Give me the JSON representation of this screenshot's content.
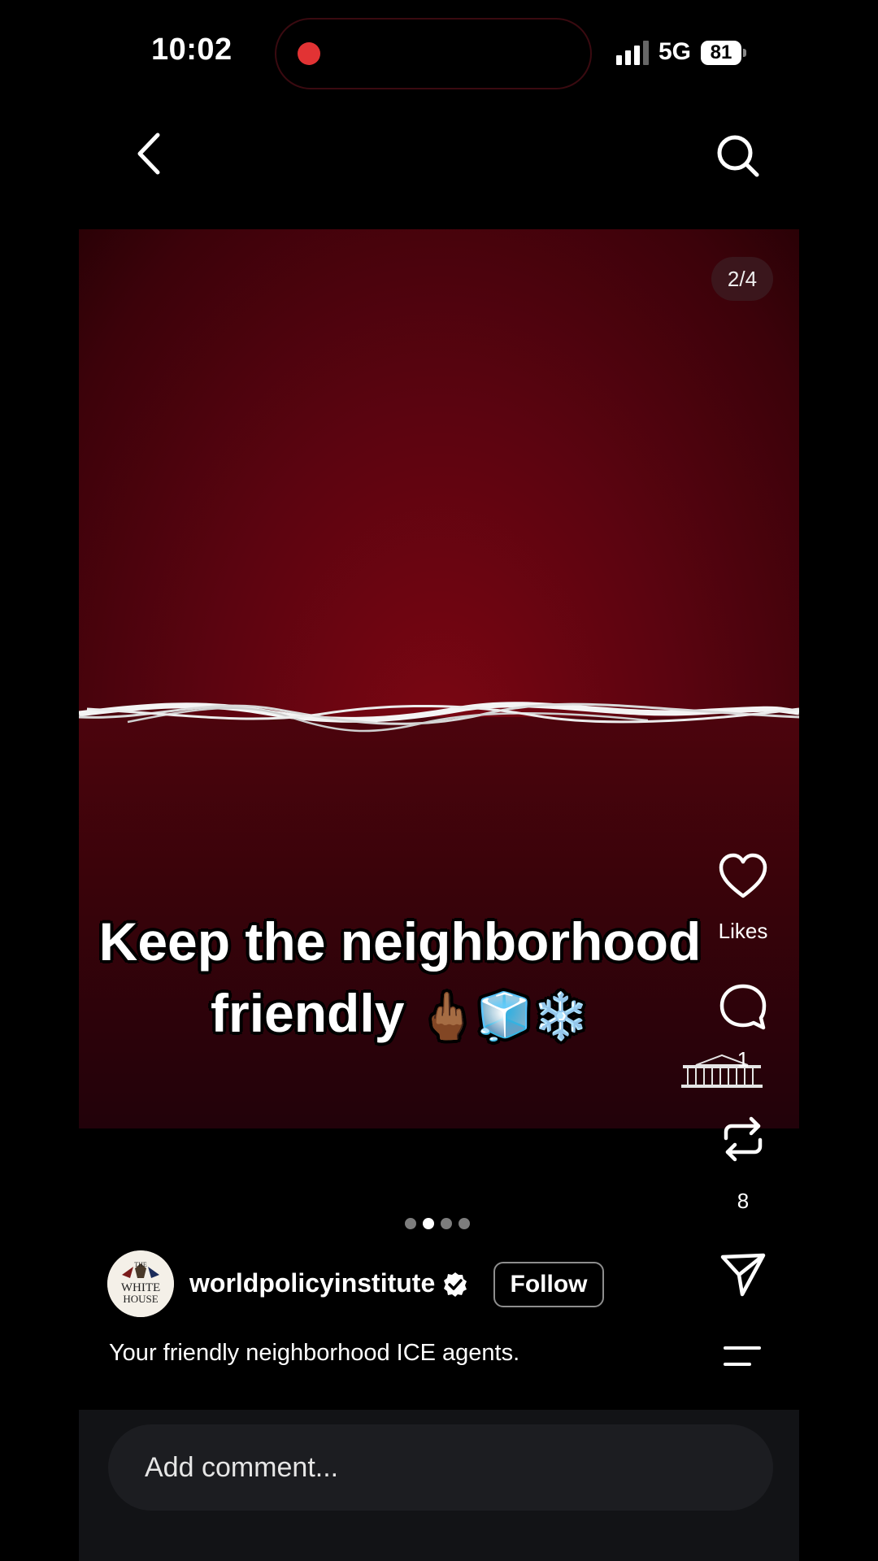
{
  "status_bar": {
    "time": "10:02",
    "network": "5G",
    "battery": "81"
  },
  "nav": {
    "back_icon": "chevron-left-icon",
    "search_icon": "search-icon"
  },
  "post": {
    "slide_counter": "2/4",
    "overlay_caption_line1": "Keep the neighborhood",
    "overlay_caption_line2_text": "friendly",
    "overlay_caption_emojis": "🖕🏾🧊❄️",
    "carousel": {
      "total": 4,
      "active_index": 1
    },
    "actions": {
      "like_label": "Likes",
      "comment_count": "1",
      "repost_count": "8"
    },
    "author": {
      "avatar_text_top": "THE",
      "avatar_text_mid": "WHITE",
      "avatar_text_bottom": "HOUSE",
      "username": "worldpolicyinstitute",
      "verified": true,
      "follow_label": "Follow"
    },
    "caption": "Your friendly neighborhood ICE agents."
  },
  "comment_box": {
    "placeholder": "Add comment..."
  },
  "colors": {
    "background": "#000000",
    "media_red": "#7c0612",
    "recording_dot": "#e23334",
    "comment_panel": "#121316"
  }
}
